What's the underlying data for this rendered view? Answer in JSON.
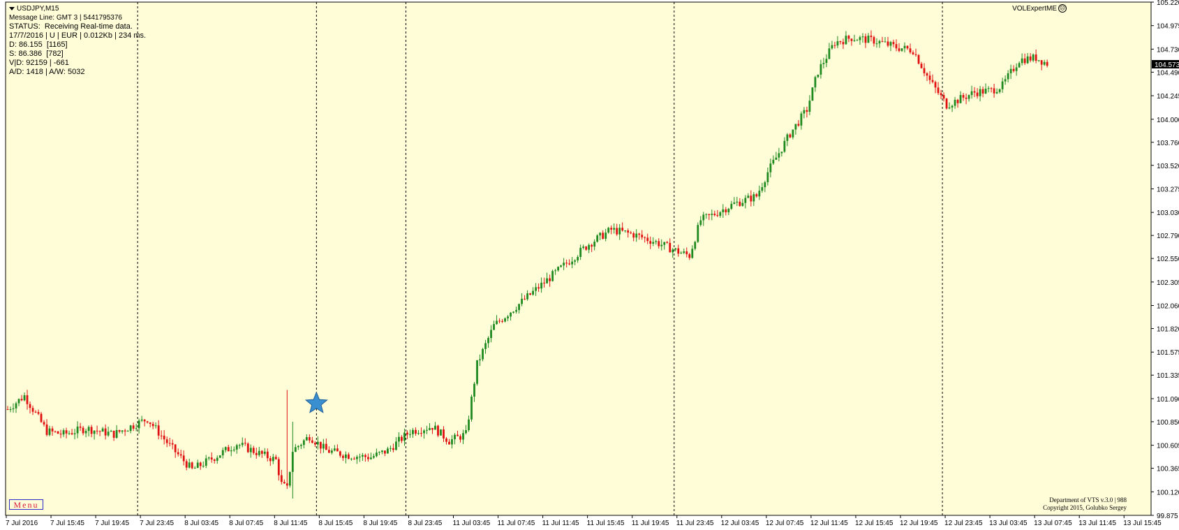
{
  "window": {
    "symbol_label": "USDJPY,M15",
    "expert_label": "VOLExpertME",
    "expert_icon": "smiley-face-icon"
  },
  "info_panel": {
    "message_line": "Message Line: GMT 3 | 5441795376",
    "status": "STATUS:  Receiving Real-time data.",
    "date_line": "17/7/2016 | U | EUR | 0.012Kb | 234 ms.",
    "d_line": "D: 86.155  [1165]",
    "s_line": "S: 86.386  [782]",
    "vd_line": "V|D: 92159 | -661",
    "ad_line": "A/D: 1418 | A/W: 5032"
  },
  "menu": {
    "label": "Menu"
  },
  "copyright": {
    "line1": "Department of VTS  v.3.0 | 988",
    "line2": "Copyright 2015, Golubko Sergey"
  },
  "colors": {
    "background": "#fffcd8",
    "bull": "#1f8a1f",
    "bear": "#e01010",
    "grid": "#000000",
    "star": "#3a8fd0",
    "price_tag": "#000000"
  },
  "chart_data": {
    "type": "candlestick",
    "symbol": "USDJPY",
    "timeframe": "M15",
    "ylim": [
      99.875,
      105.22
    ],
    "y_ticks": [
      "105.220",
      "104.975",
      "104.730",
      "104.490",
      "104.245",
      "104.000",
      "103.760",
      "103.520",
      "103.275",
      "103.030",
      "102.790",
      "102.550",
      "102.305",
      "102.060",
      "101.820",
      "101.575",
      "101.335",
      "101.090",
      "100.850",
      "100.605",
      "100.365",
      "100.120",
      "99.875"
    ],
    "current_price": "104.573",
    "x_ticks": [
      "7 Jul 2016",
      "7 Jul 15:45",
      "7 Jul 19:45",
      "7 Jul 23:45",
      "8 Jul 03:45",
      "8 Jul 07:45",
      "8 Jul 11:45",
      "8 Jul 15:45",
      "8 Jul 19:45",
      "8 Jul 23:45",
      "11 Jul 03:45",
      "11 Jul 07:45",
      "11 Jul 11:45",
      "11 Jul 15:45",
      "11 Jul 19:45",
      "11 Jul 23:45",
      "12 Jul 03:45",
      "12 Jul 07:45",
      "12 Jul 11:45",
      "12 Jul 15:45",
      "12 Jul 19:45",
      "12 Jul 23:45",
      "13 Jul 03:45",
      "13 Jul 07:45",
      "13 Jul 11:45",
      "13 Jul 15:45"
    ],
    "period_separators_after_tick": [
      "7 Jul 23:45",
      "8 Jul 15:45",
      "8 Jul 23:45",
      "11 Jul 23:45",
      "12 Jul 23:45"
    ],
    "star_marker": {
      "at_tick": "8 Jul 15:45",
      "price": 101.04
    },
    "path_keypoints": [
      [
        0,
        100.98
      ],
      [
        6,
        101.12
      ],
      [
        14,
        100.75
      ],
      [
        20,
        100.72
      ],
      [
        28,
        100.78
      ],
      [
        38,
        100.72
      ],
      [
        50,
        100.88
      ],
      [
        58,
        100.6
      ],
      [
        66,
        100.35
      ],
      [
        74,
        100.48
      ],
      [
        82,
        100.62
      ],
      [
        90,
        100.52
      ],
      [
        96,
        100.45
      ],
      [
        98,
        100.2
      ],
      [
        100,
        100.15
      ],
      [
        102,
        100.55
      ],
      [
        108,
        100.7
      ],
      [
        114,
        100.55
      ],
      [
        122,
        100.5
      ],
      [
        130,
        100.48
      ],
      [
        136,
        100.55
      ],
      [
        144,
        100.75
      ],
      [
        152,
        100.8
      ],
      [
        158,
        100.65
      ],
      [
        164,
        100.72
      ],
      [
        168,
        101.45
      ],
      [
        174,
        101.85
      ],
      [
        182,
        102.05
      ],
      [
        192,
        102.3
      ],
      [
        200,
        102.5
      ],
      [
        208,
        102.7
      ],
      [
        216,
        102.85
      ],
      [
        224,
        102.8
      ],
      [
        232,
        102.72
      ],
      [
        240,
        102.62
      ],
      [
        244,
        102.58
      ],
      [
        248,
        102.95
      ],
      [
        252,
        103.0
      ],
      [
        260,
        103.12
      ],
      [
        268,
        103.2
      ],
      [
        272,
        103.45
      ],
      [
        280,
        103.85
      ],
      [
        286,
        104.1
      ],
      [
        290,
        104.5
      ],
      [
        296,
        104.8
      ],
      [
        302,
        104.85
      ],
      [
        310,
        104.82
      ],
      [
        318,
        104.75
      ],
      [
        324,
        104.72
      ],
      [
        330,
        104.4
      ],
      [
        336,
        104.15
      ],
      [
        340,
        104.2
      ],
      [
        346,
        104.28
      ],
      [
        352,
        104.3
      ],
      [
        356,
        104.35
      ],
      [
        362,
        104.62
      ],
      [
        368,
        104.64
      ],
      [
        372,
        104.58
      ]
    ]
  }
}
